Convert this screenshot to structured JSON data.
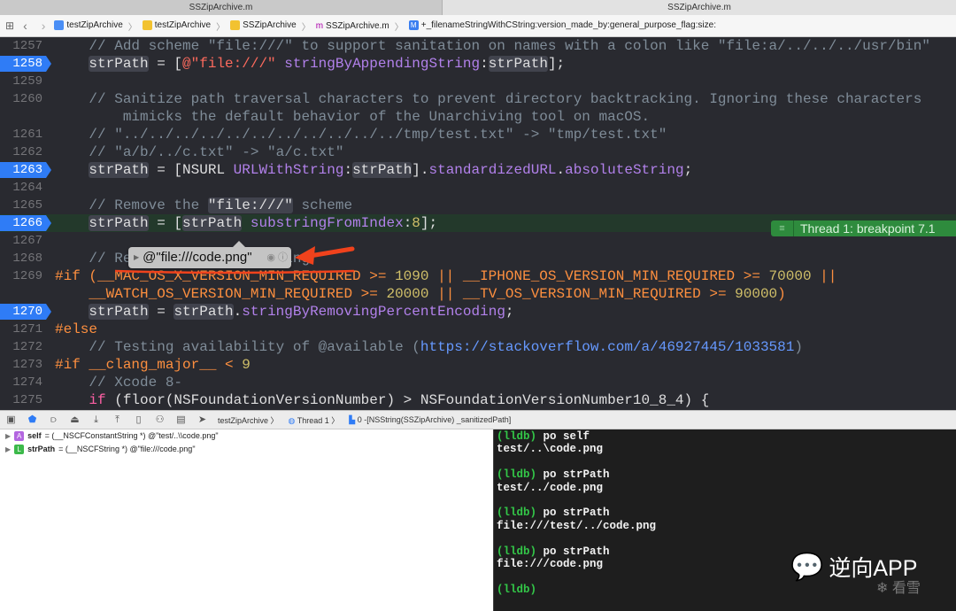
{
  "window": {
    "tab_active": "SSZipArchive.m",
    "tab_other": "SSZipArchive.m"
  },
  "jumpbar": {
    "items": [
      "testZipArchive",
      "testZipArchive",
      "SSZipArchive",
      "SSZipArchive.m",
      "+_filenameStringWithCString:version_made_by:general_purpose_flag:size:"
    ]
  },
  "code": {
    "lines": [
      {
        "num": "1257",
        "segs": [
          [
            "com",
            "    // Add scheme \"file:///\" to support sanitation on names with a colon like \"file:a/../../../usr/bin\""
          ]
        ]
      },
      {
        "num": "1258",
        "bp": true,
        "segs": [
          [
            "pl",
            "    "
          ],
          [
            "var",
            "strPath"
          ],
          [
            "pl",
            " = ["
          ],
          [
            "str",
            "@\"file:///\""
          ],
          [
            "pl",
            " "
          ],
          [
            "meth",
            "stringByAppendingString"
          ],
          [
            "pl",
            ":"
          ],
          [
            "var",
            "strPath"
          ],
          [
            "pl",
            "];"
          ]
        ]
      },
      {
        "num": "1259",
        "segs": []
      },
      {
        "num": "1260",
        "segs": [
          [
            "com",
            "    // Sanitize path traversal characters to prevent directory backtracking. Ignoring these characters"
          ]
        ]
      },
      {
        "num": "",
        "segs": [
          [
            "com",
            "        mimicks the default behavior of the Unarchiving tool on macOS."
          ]
        ]
      },
      {
        "num": "1261",
        "segs": [
          [
            "com",
            "    // \"../../../../../../../../../../../tmp/test.txt\" -> \"tmp/test.txt\""
          ]
        ]
      },
      {
        "num": "1262",
        "segs": [
          [
            "com",
            "    // \"a/b/../c.txt\" -> \"a/c.txt\""
          ]
        ]
      },
      {
        "num": "1263",
        "bp": true,
        "segs": [
          [
            "pl",
            "    "
          ],
          [
            "var",
            "strPath"
          ],
          [
            "pl",
            " = [NSURL "
          ],
          [
            "meth",
            "URLWithString"
          ],
          [
            "pl",
            ":"
          ],
          [
            "var",
            "strPath"
          ],
          [
            "pl",
            "]."
          ],
          [
            "meth",
            "standardizedURL"
          ],
          [
            "pl",
            "."
          ],
          [
            "meth",
            "absoluteString"
          ],
          [
            "pl",
            ";"
          ]
        ]
      },
      {
        "num": "1264",
        "segs": []
      },
      {
        "num": "1265",
        "segs": [
          [
            "com",
            "    // Remove the "
          ],
          [
            "var",
            "\"file:///\""
          ],
          [
            "com",
            " scheme"
          ]
        ]
      },
      {
        "num": "1266",
        "bp": true,
        "cur": true,
        "segs": [
          [
            "pl",
            "    "
          ],
          [
            "var",
            "strPath"
          ],
          [
            "pl",
            " = ["
          ],
          [
            "var",
            "strPath"
          ],
          [
            "pl",
            " "
          ],
          [
            "meth",
            "substringFromIndex"
          ],
          [
            "pl",
            ":"
          ],
          [
            "num",
            "8"
          ],
          [
            "pl",
            "];"
          ]
        ]
      },
      {
        "num": "1267",
        "segs": []
      },
      {
        "num": "1268",
        "segs": [
          [
            "com",
            "    // Remove percent encoding"
          ]
        ]
      },
      {
        "num": "1269",
        "segs": [
          [
            "pp",
            "#if (__MAC_OS_X_VERSION_MIN_REQUIRED >= "
          ],
          [
            "num",
            "1090"
          ],
          [
            "pp",
            " || __IPHONE_OS_VERSION_MIN_REQUIRED >= "
          ],
          [
            "num",
            "70000"
          ],
          [
            "pp",
            " ||"
          ]
        ]
      },
      {
        "num": "",
        "segs": [
          [
            "pp",
            "    __WATCH_OS_VERSION_MIN_REQUIRED >= "
          ],
          [
            "num",
            "20000"
          ],
          [
            "pp",
            " || __TV_OS_VERSION_MIN_REQUIRED >= "
          ],
          [
            "num",
            "90000"
          ],
          [
            "pp",
            ")"
          ]
        ]
      },
      {
        "num": "1270",
        "bp": true,
        "segs": [
          [
            "pl",
            "    "
          ],
          [
            "var",
            "strPath"
          ],
          [
            "pl",
            " = "
          ],
          [
            "var",
            "strPath"
          ],
          [
            "pl",
            "."
          ],
          [
            "meth",
            "stringByRemovingPercentEncoding"
          ],
          [
            "pl",
            ";"
          ]
        ]
      },
      {
        "num": "1271",
        "segs": [
          [
            "pp",
            "#else"
          ]
        ]
      },
      {
        "num": "1272",
        "segs": [
          [
            "com",
            "    // Testing availability of @available ("
          ],
          [
            "url",
            "https://stackoverflow.com/a/46927445/1033581"
          ],
          [
            "com",
            ")"
          ]
        ]
      },
      {
        "num": "1273",
        "segs": [
          [
            "pp",
            "#if __clang_major__ < "
          ],
          [
            "num",
            "9"
          ]
        ]
      },
      {
        "num": "1274",
        "segs": [
          [
            "com",
            "    // Xcode 8-"
          ]
        ]
      },
      {
        "num": "1275",
        "segs": [
          [
            "pl",
            "    "
          ],
          [
            "kw",
            "if"
          ],
          [
            "pl",
            " (floor(NSFoundationVersionNumber) > NSFoundationVersionNumber10_8_4) {"
          ]
        ]
      }
    ]
  },
  "annotation": {
    "label": "Thread 1: breakpoint 7.1"
  },
  "popover": {
    "value": "@\"file:///code.png\""
  },
  "debugbar": {
    "target": "testZipArchive",
    "thread": "Thread 1",
    "frame": "0 -[NSString(SSZipArchive) _sanitizedPath]"
  },
  "variables": [
    {
      "badge": "A",
      "name": "self",
      "value": "= (__NSCFConstantString *) @\"test/..\\\\code.png\"",
      "color": "#b366e0"
    },
    {
      "badge": "L",
      "name": "strPath",
      "value": "= (__NSCFString *) @\"file:///code.png\"",
      "color": "#3cb94a"
    }
  ],
  "console": [
    {
      "prompt": "(lldb)",
      "text": " po self"
    },
    {
      "text": "test/..\\code.png"
    },
    {
      "text": ""
    },
    {
      "prompt": "(lldb)",
      "text": " po strPath"
    },
    {
      "text": "test/../code.png"
    },
    {
      "text": ""
    },
    {
      "prompt": "(lldb)",
      "text": " po strPath"
    },
    {
      "text": "file:///test/../code.png"
    },
    {
      "text": ""
    },
    {
      "prompt": "(lldb)",
      "text": " po strPath"
    },
    {
      "text": "file:///code.png"
    },
    {
      "text": ""
    },
    {
      "prompt": "(lldb)",
      "text": ""
    }
  ],
  "watermark": {
    "title": "逆向APP",
    "sub": "看雪"
  }
}
